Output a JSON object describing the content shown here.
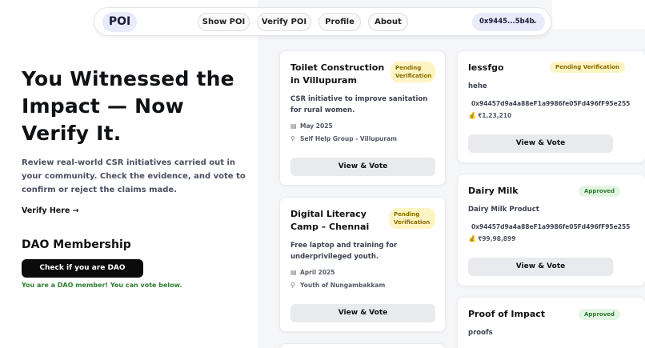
{
  "nav": {
    "logo": "POI",
    "links": [
      "Show POI",
      "Verify POI",
      "Profile",
      "About"
    ],
    "wallet": "0x9445...5b4b"
  },
  "hero": {
    "title_lines": [
      "You Witnessed the",
      "Impact — Now",
      "Verify It."
    ],
    "description": "Review real-world CSR initiatives carried out in your community. Check the evidence, and vote to confirm or reject the claims made.",
    "verify_link": "Verify Here →"
  },
  "dao": {
    "title": "DAO Membership",
    "button": "Check if you are DAO member",
    "message": "You are a DAO member! You can vote below."
  },
  "cards_left": [
    {
      "title": "Toilet Construction in Villupuram",
      "status": "Pending Verification",
      "description": "CSR initiative to improve sanitation for rural women.",
      "date": "May 2025",
      "location": "Self Help Group - Villupuram",
      "button": "View & Vote"
    },
    {
      "title": "Digital Literacy Camp – Chennai",
      "status": "Pending Verification",
      "description": "Free laptop and training for underprivileged youth.",
      "date": "April 2025",
      "location": "Youth of Nungambakkam",
      "button": "View & Vote"
    }
  ],
  "cards_right": [
    {
      "title": "lessfgo",
      "status": "Pending Verification",
      "description": "hehe",
      "address": "0x94457d9a4a88eF1a9986fe05Fd496fF95e255",
      "amount": "₹1,23,210",
      "button": "View & Vote"
    },
    {
      "title": "Dairy Milk",
      "status": "Approved",
      "description": "Dairy Milk Product",
      "address": "0x94457d9a4a88eF1a9986fe05Fd496fF95e255",
      "amount": "₹99,98,899",
      "button": "View & Vote"
    },
    {
      "title": "Proof of Impact",
      "status": "Approved",
      "description": "proofs"
    }
  ],
  "icons": {
    "calendar": "calendar-icon",
    "location": "location-pin-icon",
    "money": "money-bag-icon",
    "chevron": "chevron-down-icon"
  }
}
